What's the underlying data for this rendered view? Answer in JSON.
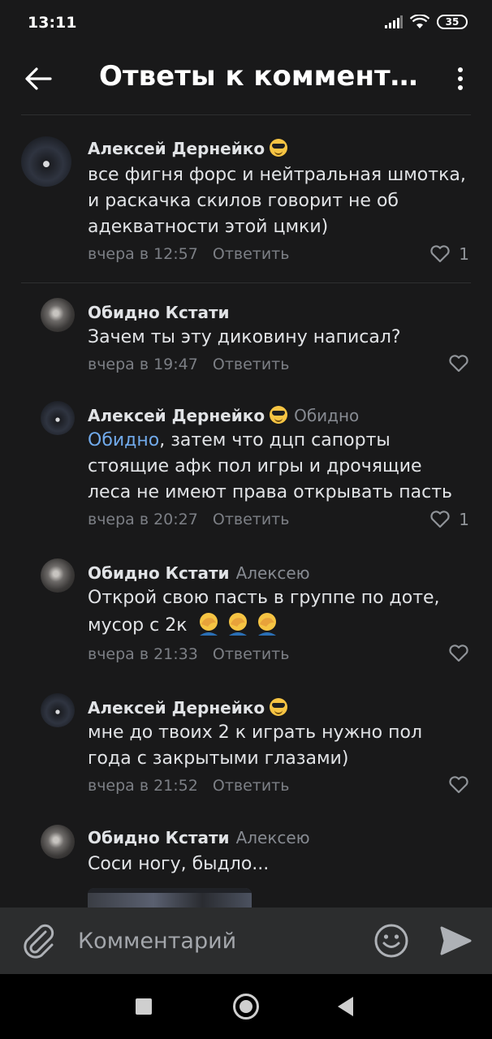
{
  "status_bar": {
    "time": "13:11",
    "battery": "35"
  },
  "header": {
    "title": "Ответы к комментарию",
    "back_icon": "arrow-left-icon",
    "more_icon": "more-vertical-icon"
  },
  "comments": [
    {
      "author": "Алексей Дернейко",
      "author_emoji": "sunglasses-emoji",
      "reply_to": "",
      "mention": "",
      "text": "все фигня форс и нейтральная шмотка, и раскачка скилов говорит не об адекватности этой цмки)",
      "time": "вчера в 12:57",
      "reply_label": "Ответить",
      "likes": "1"
    },
    {
      "author": "Обидно Кстати",
      "reply_to": "",
      "mention": "",
      "text": "Зачем ты эту диковину написал?",
      "time": "вчера в 19:47",
      "reply_label": "Ответить",
      "likes": ""
    },
    {
      "author": "Алексей Дернейко",
      "author_emoji": "sunglasses-emoji",
      "reply_to": "Обидно",
      "mention": "Обидно",
      "text": ", затем что дцп сапорты стоящие афк пол игры и дрочящие леса не имеют права открывать пасть",
      "time": "вчера в 20:27",
      "reply_label": "Ответить",
      "likes": "1"
    },
    {
      "author": "Обидно Кстати",
      "reply_to": "Алексею",
      "mention": "",
      "text": "Открой свою пасть в группе по доте, мусор с 2к",
      "text_emoji": "facepalm-emoji",
      "time": "вчера в 21:33",
      "reply_label": "Ответить",
      "likes": ""
    },
    {
      "author": "Алексей Дернейко",
      "author_emoji": "sunglasses-emoji",
      "reply_to": "",
      "mention": "",
      "text": "мне до твоих 2 к играть нужно пол года с закрытыми глазами)",
      "time": "вчера в 21:52",
      "reply_label": "Ответить",
      "likes": ""
    },
    {
      "author": "Обидно Кстати",
      "reply_to": "Алексею",
      "mention": "",
      "text": "Соси ногу, быдло...",
      "time": "",
      "reply_label": "",
      "likes": ""
    }
  ],
  "composer": {
    "placeholder": "Комментарий",
    "attach_icon": "paperclip-icon",
    "emoji_icon": "smile-icon",
    "send_icon": "send-icon"
  },
  "colors": {
    "background": "#19191a",
    "accent_link": "#71aaeb",
    "text_primary": "#e1e3e6",
    "text_secondary": "#7c7f85",
    "composer_bg": "#2c2d2e"
  }
}
